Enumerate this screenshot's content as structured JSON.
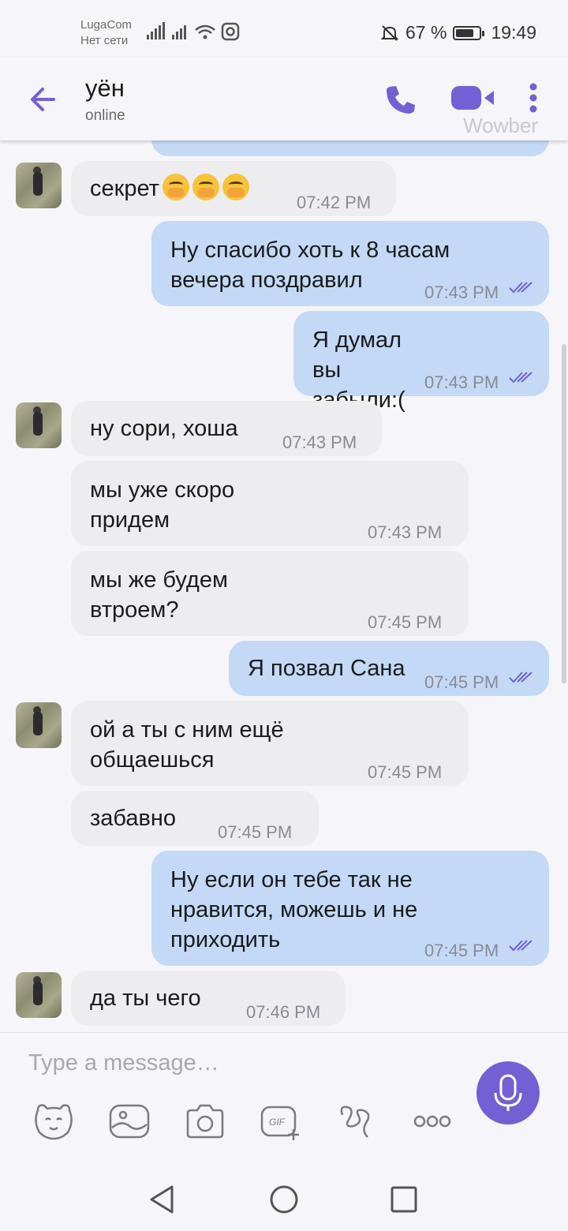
{
  "status_bar": {
    "carrier": "LugaCom",
    "network": "Нет сети",
    "battery_percent": "67 %",
    "battery_level": 0.67,
    "time": "19:49"
  },
  "header": {
    "name": "уён",
    "status": "online",
    "watermark": "Wowber",
    "icons": [
      "back-arrow-icon",
      "phone-icon",
      "video-camera-icon",
      "more-vertical-icon"
    ],
    "accent_color": "#7360d4"
  },
  "messages": [
    {
      "side": "in",
      "text": "секрет",
      "emoji": [
        "hand-over-mouth",
        "hand-over-mouth",
        "hand-over-mouth"
      ],
      "time": "07:42 PM"
    },
    {
      "side": "out",
      "text": "Ну спасибо хоть к 8 часам вечера поздравил",
      "time": "07:43 PM"
    },
    {
      "side": "out",
      "text": "Я думал вы забыли:(",
      "time": "07:43 PM"
    },
    {
      "side": "in",
      "text": "ну сори, хоша",
      "time": "07:43 PM"
    },
    {
      "side": "in",
      "text": "мы уже скоро придем",
      "time": "07:43 PM"
    },
    {
      "side": "in",
      "text": "мы же будем втроем?",
      "time": "07:45 PM"
    },
    {
      "side": "out",
      "text": "Я позвал Сана",
      "time": "07:45 PM"
    },
    {
      "side": "in",
      "text": "ой а ты с ним ещё общаешься",
      "time": "07:45 PM"
    },
    {
      "side": "in",
      "text": "забавно",
      "time": "07:45 PM"
    },
    {
      "side": "out",
      "text": "Ну если он тебе так не нравится, можешь и не приходить",
      "time": "07:45 PM"
    },
    {
      "side": "in",
      "text": "да ты чего",
      "time": "07:46 PM"
    }
  ],
  "input": {
    "placeholder": "Type a message…",
    "tools": [
      "sticker-icon",
      "gallery-icon",
      "camera-icon",
      "gif-icon",
      "doodle-icon",
      "more-horizontal-icon"
    ],
    "mic_icon": "microphone-icon"
  },
  "nav_bar": [
    "back-triangle-icon",
    "home-circle-icon",
    "recents-square-icon"
  ],
  "colors": {
    "incoming_bubble": "#ededf0",
    "outgoing_bubble": "#c3d9f6",
    "read_ticks": "#7360d4"
  }
}
